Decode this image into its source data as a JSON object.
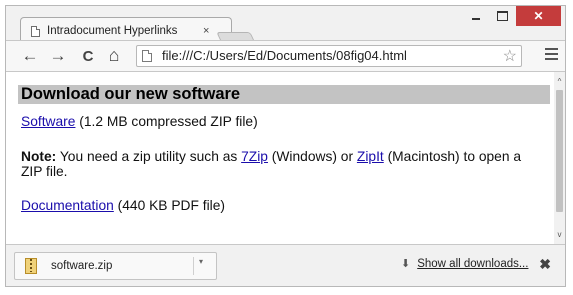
{
  "tab": {
    "title": "Intradocument Hyperlinks",
    "close_glyph": "×"
  },
  "window_controls": {
    "minimize": "–",
    "maximize": "□",
    "close": "✕"
  },
  "toolbar": {
    "back_glyph": "←",
    "forward_glyph": "→",
    "reload_glyph": "C",
    "home_glyph": "⌂",
    "url": "file:///C:/Users/Ed/Documents/08fig04.html",
    "star_glyph": "☆"
  },
  "content": {
    "heading": "Download our new software",
    "software_link": "Software",
    "software_desc": " (1.2 MB compressed ZIP file)",
    "note_label": "Note:",
    "note_text_1": " You need a zip utility such as ",
    "link_7zip": "7Zip",
    "note_text_2": " (Windows) or ",
    "link_zipit": "ZipIt",
    "note_text_3": " (Macintosh) to open a ZIP file.",
    "documentation_link": "Documentation",
    "documentation_desc": " (440 KB PDF file)"
  },
  "scrollbar": {
    "up_glyph": "^",
    "down_glyph": "v"
  },
  "downloads_bar": {
    "file_name": "software.zip",
    "caret_glyph": "▾",
    "show_all_label": "Show all downloads...",
    "download_arrow_glyph": "⬇",
    "close_glyph": "✖"
  },
  "colors": {
    "link": "#1a0dab",
    "heading_bg": "#c3c3c3",
    "close_button": "#c43c3c"
  }
}
